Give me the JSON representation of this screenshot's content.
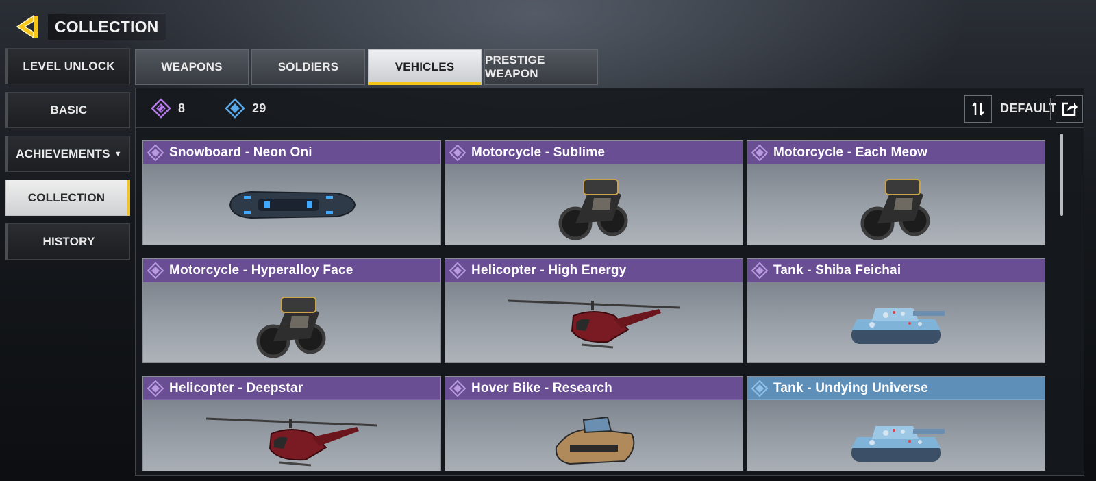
{
  "header": {
    "title": "COLLECTION",
    "back_icon": "back-arrow-icon",
    "accent": "#f5c518"
  },
  "sidebar": {
    "items": [
      {
        "label": "LEVEL UNLOCK"
      },
      {
        "label": "BASIC"
      },
      {
        "label": "ACHIEVEMENTS"
      },
      {
        "label": "COLLECTION",
        "active": true
      },
      {
        "label": "HISTORY"
      }
    ]
  },
  "tabs": [
    {
      "label": "WEAPONS"
    },
    {
      "label": "SOLDIERS"
    },
    {
      "label": "VEHICLES",
      "active": true
    },
    {
      "label": "PRESTIGE WEAPON"
    }
  ],
  "stats": {
    "epic_count": "8",
    "rare_count": "29",
    "epic_color": "#b67be8",
    "rare_color": "#5aa8e8"
  },
  "toolbar": {
    "sort_label": "DEFAULT",
    "sort_icon": "sort-icon",
    "export_icon": "export-icon"
  },
  "cards": [
    {
      "title": "Snowboard - Neon Oni",
      "rarity": "epic",
      "vehicle": "snowboard"
    },
    {
      "title": "Motorcycle - Sublime",
      "rarity": "epic",
      "vehicle": "motorcycle"
    },
    {
      "title": "Motorcycle - Each Meow",
      "rarity": "epic",
      "vehicle": "motorcycle"
    },
    {
      "title": "Motorcycle - Hyperalloy Face",
      "rarity": "epic",
      "vehicle": "motorcycle"
    },
    {
      "title": "Helicopter - High Energy",
      "rarity": "epic",
      "vehicle": "helicopter"
    },
    {
      "title": "Tank - Shiba Feichai",
      "rarity": "epic",
      "vehicle": "tank"
    },
    {
      "title": "Helicopter - Deepstar",
      "rarity": "epic",
      "vehicle": "helicopter"
    },
    {
      "title": "Hover Bike - Research",
      "rarity": "epic",
      "vehicle": "hover-bike"
    },
    {
      "title": "Tank - Undying Universe",
      "rarity": "rare",
      "vehicle": "tank"
    }
  ]
}
